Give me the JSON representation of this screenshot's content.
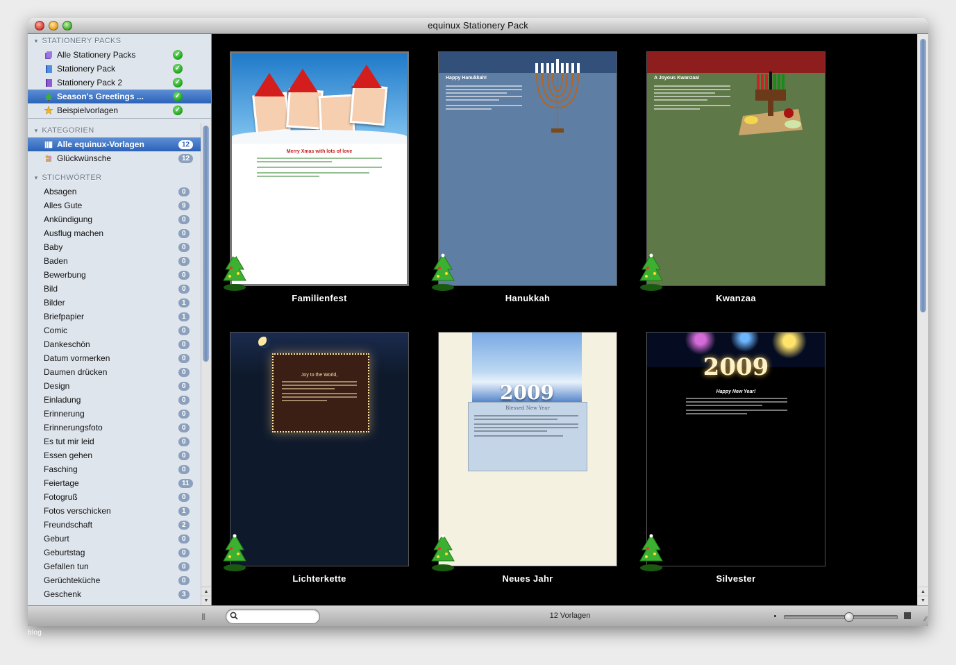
{
  "window": {
    "title": "equinux Stationery Pack"
  },
  "sidebar": {
    "packs_header": "STATIONERY PACKS",
    "packs": [
      {
        "label": "Alle Stationery Packs",
        "icon": "stack-icon",
        "selected": false
      },
      {
        "label": "Stationery Pack",
        "icon": "blue-book-icon",
        "selected": false
      },
      {
        "label": "Stationery Pack 2",
        "icon": "purple-book-icon",
        "selected": false
      },
      {
        "label": "Season's Greetings ...",
        "icon": "tree-icon",
        "selected": true
      },
      {
        "label": "Beispielvorlagen",
        "icon": "star-icon",
        "selected": false
      }
    ],
    "cats_header": "KATEGORIEN",
    "categories": [
      {
        "label": "Alle equinux-Vorlagen",
        "count": "12",
        "selected": true
      },
      {
        "label": "Glückwünsche",
        "count": "12",
        "selected": false
      }
    ],
    "kw_header": "STICHWÖRTER",
    "keywords": [
      {
        "label": "Absagen",
        "count": "0"
      },
      {
        "label": "Alles Gute",
        "count": "9"
      },
      {
        "label": "Ankündigung",
        "count": "0"
      },
      {
        "label": "Ausflug machen",
        "count": "0"
      },
      {
        "label": "Baby",
        "count": "0"
      },
      {
        "label": "Baden",
        "count": "0"
      },
      {
        "label": "Bewerbung",
        "count": "0"
      },
      {
        "label": "Bild",
        "count": "0"
      },
      {
        "label": "Bilder",
        "count": "1"
      },
      {
        "label": "Briefpapier",
        "count": "1"
      },
      {
        "label": "Comic",
        "count": "0"
      },
      {
        "label": "Dankeschön",
        "count": "0"
      },
      {
        "label": "Datum vormerken",
        "count": "0"
      },
      {
        "label": "Daumen drücken",
        "count": "0"
      },
      {
        "label": "Design",
        "count": "0"
      },
      {
        "label": "Einladung",
        "count": "0"
      },
      {
        "label": "Erinnerung",
        "count": "0"
      },
      {
        "label": "Erinnerungsfoto",
        "count": "0"
      },
      {
        "label": "Es tut mir leid",
        "count": "0"
      },
      {
        "label": "Essen gehen",
        "count": "0"
      },
      {
        "label": "Fasching",
        "count": "0"
      },
      {
        "label": "Feiertage",
        "count": "11"
      },
      {
        "label": "Fotogruß",
        "count": "0"
      },
      {
        "label": "Fotos verschicken",
        "count": "1"
      },
      {
        "label": "Freundschaft",
        "count": "2"
      },
      {
        "label": "Geburt",
        "count": "0"
      },
      {
        "label": "Geburtstag",
        "count": "0"
      },
      {
        "label": "Gefallen tun",
        "count": "0"
      },
      {
        "label": "Gerüchteküche",
        "count": "0"
      },
      {
        "label": "Geschenk",
        "count": "3"
      }
    ]
  },
  "templates": [
    {
      "name": "Familienfest",
      "heading": "Merry Xmas with lots of love"
    },
    {
      "name": "Hanukkah",
      "heading": "Happy Hanukkah!"
    },
    {
      "name": "Kwanzaa",
      "heading": "A Joyous Kwanzaa!"
    },
    {
      "name": "Lichterkette",
      "heading": "Joy to the World,"
    },
    {
      "name": "Neues Jahr",
      "heading": "Blessed New Year",
      "year": "2009"
    },
    {
      "name": "Silvester",
      "heading": "Happy New Year!",
      "year": "2009"
    }
  ],
  "bottombar": {
    "search_placeholder": "",
    "count_text": "12 Vorlagen",
    "zoom_level": 0.57
  },
  "watermark": "blog",
  "colors": {
    "selection": "#2b63b8",
    "badge": "#8ba0bd",
    "check": "#21a61c"
  }
}
